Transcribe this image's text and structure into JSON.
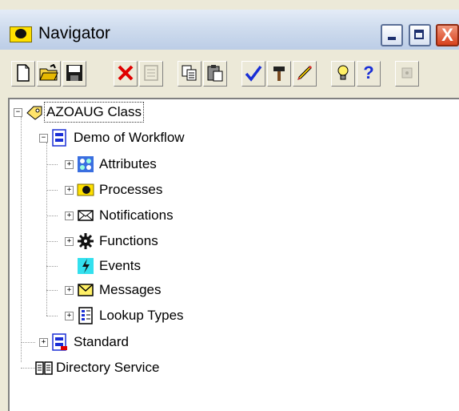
{
  "window": {
    "title": "Navigator"
  },
  "titlebar_buttons": {
    "close_glyph": "X"
  },
  "toolbar": [
    {
      "icon": "new-document-icon",
      "disabled": false
    },
    {
      "icon": "open-folder-icon",
      "disabled": false
    },
    {
      "icon": "save-icon",
      "disabled": false
    },
    {
      "icon": "delete-icon",
      "disabled": false
    },
    {
      "icon": "properties-icon",
      "disabled": true
    },
    {
      "icon": "copy-icon",
      "disabled": false
    },
    {
      "icon": "paste-icon",
      "disabled": false
    },
    {
      "icon": "verify-icon",
      "disabled": false
    },
    {
      "icon": "hammer-icon",
      "disabled": false
    },
    {
      "icon": "edit-pencil-icon",
      "disabled": false
    },
    {
      "icon": "lightbulb-icon",
      "disabled": false
    },
    {
      "icon": "help-icon",
      "disabled": false,
      "glyph": "?"
    },
    {
      "icon": "stop-icon",
      "disabled": true
    }
  ],
  "tree": {
    "root": {
      "label": "AZOAUG Class",
      "expanded": true,
      "selected": true
    },
    "workflow": {
      "label": "Demo of Workflow",
      "expanded": true
    },
    "children": [
      {
        "label": "Attributes",
        "icon": "attributes-icon",
        "expandable": true
      },
      {
        "label": "Processes",
        "icon": "processes-icon",
        "expandable": true
      },
      {
        "label": "Notifications",
        "icon": "envelope-icon",
        "expandable": true
      },
      {
        "label": "Functions",
        "icon": "gear-icon",
        "expandable": true
      },
      {
        "label": "Events",
        "icon": "lightning-icon",
        "expandable": false
      },
      {
        "label": "Messages",
        "icon": "message-icon",
        "expandable": true
      },
      {
        "label": "Lookup Types",
        "icon": "lookup-icon",
        "expandable": true
      }
    ],
    "standard": {
      "label": "Standard",
      "expanded": false
    },
    "directory": {
      "label": "Directory Service"
    }
  },
  "colors": {
    "titlebar_bg": "#cfdcee",
    "close_button": "#d8411d",
    "selection_outline": "#333333"
  }
}
